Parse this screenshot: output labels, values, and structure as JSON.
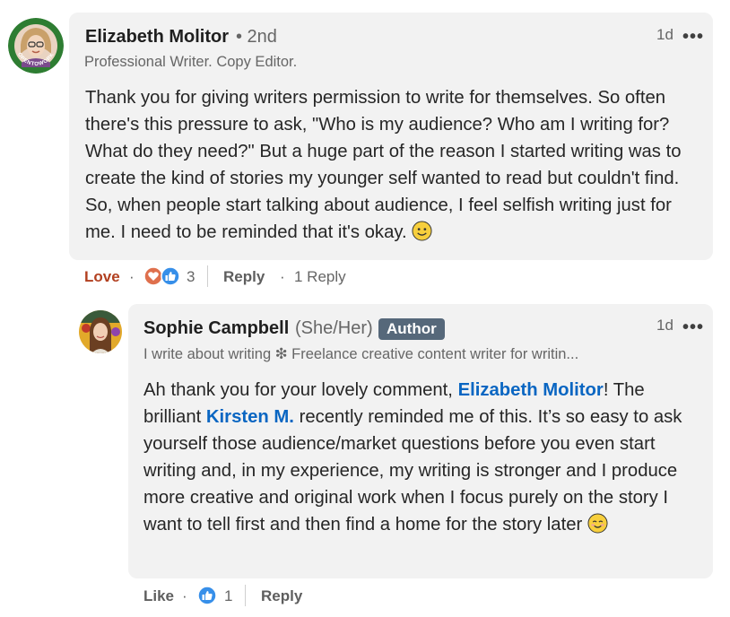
{
  "comment1": {
    "author_name": "Elizabeth Molitor",
    "degree": "• 2nd",
    "headline": "Professional Writer. Copy Editor.",
    "time": "1d",
    "more": "•••",
    "body": "Thank you for giving writers permission to write for themselves. So often there's this pressure to ask, \"Who is my audience? Who am I writing for? What do they need?\" But a huge part of the reason I started writing was to create the kind of stories my younger self wanted to read but couldn't find. So, when people start talking about audience, I feel selfish writing just for me. I need to be reminded that it's okay.",
    "emoji": "smiley-face-icon",
    "actions": {
      "reaction_label": "Love",
      "dot": "·",
      "reaction_count": "3",
      "reply_label": "Reply",
      "reply_count": "1 Reply"
    },
    "avatar_badge_text": "OPENTOWORK"
  },
  "comment2": {
    "author_name": "Sophie Campbell",
    "pronouns": "(She/Her)",
    "badge": "Author",
    "headline": "I write about writing ❇ Freelance creative content writer for writin...",
    "time": "1d",
    "more": "•••",
    "body_part1": "Ah thank you for your lovely comment, ",
    "mention1": "Elizabeth Molitor",
    "body_part2": "! The brilliant ",
    "mention2": "Kirsten M.",
    "body_part3": " recently reminded me of this. It’s so easy to ask yourself those audience/market questions before you even start writing and, in my experience, my writing is stronger and I produce more creative and original work when I focus purely on the story I want to tell first and then find a home for the story later",
    "emoji": "smiling-blush-face-icon",
    "actions": {
      "reaction_label": "Like",
      "dot": "·",
      "reaction_count": "1",
      "reply_label": "Reply"
    }
  },
  "colors": {
    "bubble": "#f2f2f2",
    "mention": "#0a66c2",
    "love": "#b24020",
    "badge": "#56687a",
    "open_to_work": "#057642"
  }
}
